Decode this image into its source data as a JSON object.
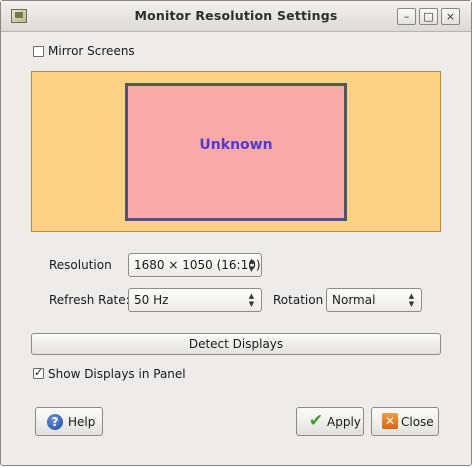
{
  "window": {
    "title": "Monitor Resolution Settings",
    "controls": {
      "minimize": "–",
      "maximize": "□",
      "close": "×"
    }
  },
  "mirror_screens": {
    "label": "Mirror Screens",
    "checked": false
  },
  "preview": {
    "monitor_name": "Unknown"
  },
  "resolution": {
    "label": "Resolution",
    "value": "1680 × 1050 (16:10)"
  },
  "refresh_rate": {
    "label": "Refresh Rate:",
    "value": "50 Hz"
  },
  "rotation": {
    "label": "Rotation",
    "value": "Normal"
  },
  "detect_displays": {
    "label": "Detect Displays"
  },
  "show_in_panel": {
    "label": "Show Displays in Panel",
    "checked": true
  },
  "buttons": {
    "help": "Help",
    "apply": "Apply",
    "close": "Close"
  },
  "icons": {
    "help": "help-icon",
    "apply": "checkmark-icon",
    "close": "close-x-icon",
    "app": "monitor-app-icon",
    "arrows": "up-down-arrows-icon"
  },
  "colors": {
    "preview_bg": "#fcd287",
    "monitor_fill": "#f9a9a9",
    "monitor_border": "#50566b",
    "monitor_text": "#4f3bd3"
  }
}
